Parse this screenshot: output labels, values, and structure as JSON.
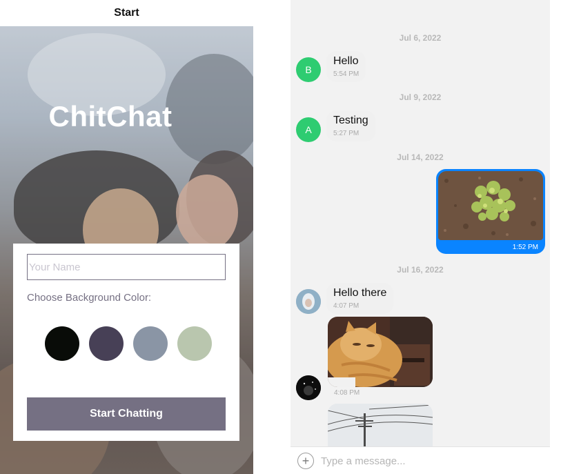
{
  "start": {
    "nav_title": "Start",
    "app_title": "ChitChat",
    "name_placeholder": "Your Name",
    "color_label": "Choose Background Color:",
    "colors": [
      "#090c08",
      "#474056",
      "#8a95a5",
      "#b9c6ae"
    ],
    "start_button": "Start Chatting"
  },
  "chat": {
    "messages": [
      {
        "date": "Jul 6, 2022",
        "avatar": "B",
        "text": "Hello",
        "time": "5:54 PM"
      },
      {
        "date": "Jul 9, 2022",
        "avatar": "A",
        "text": "Testing",
        "time": "5:27 PM"
      },
      {
        "date": "Jul 14, 2022",
        "image": "plant-photo",
        "time": "1:52 PM"
      },
      {
        "date": "Jul 16, 2022",
        "text": "Hello there",
        "time": "4:07 PM"
      },
      {
        "image": "cat-photo",
        "time": "4:08 PM"
      },
      {
        "image": "power-pole-photo"
      }
    ],
    "input_placeholder": "Type a message..."
  }
}
